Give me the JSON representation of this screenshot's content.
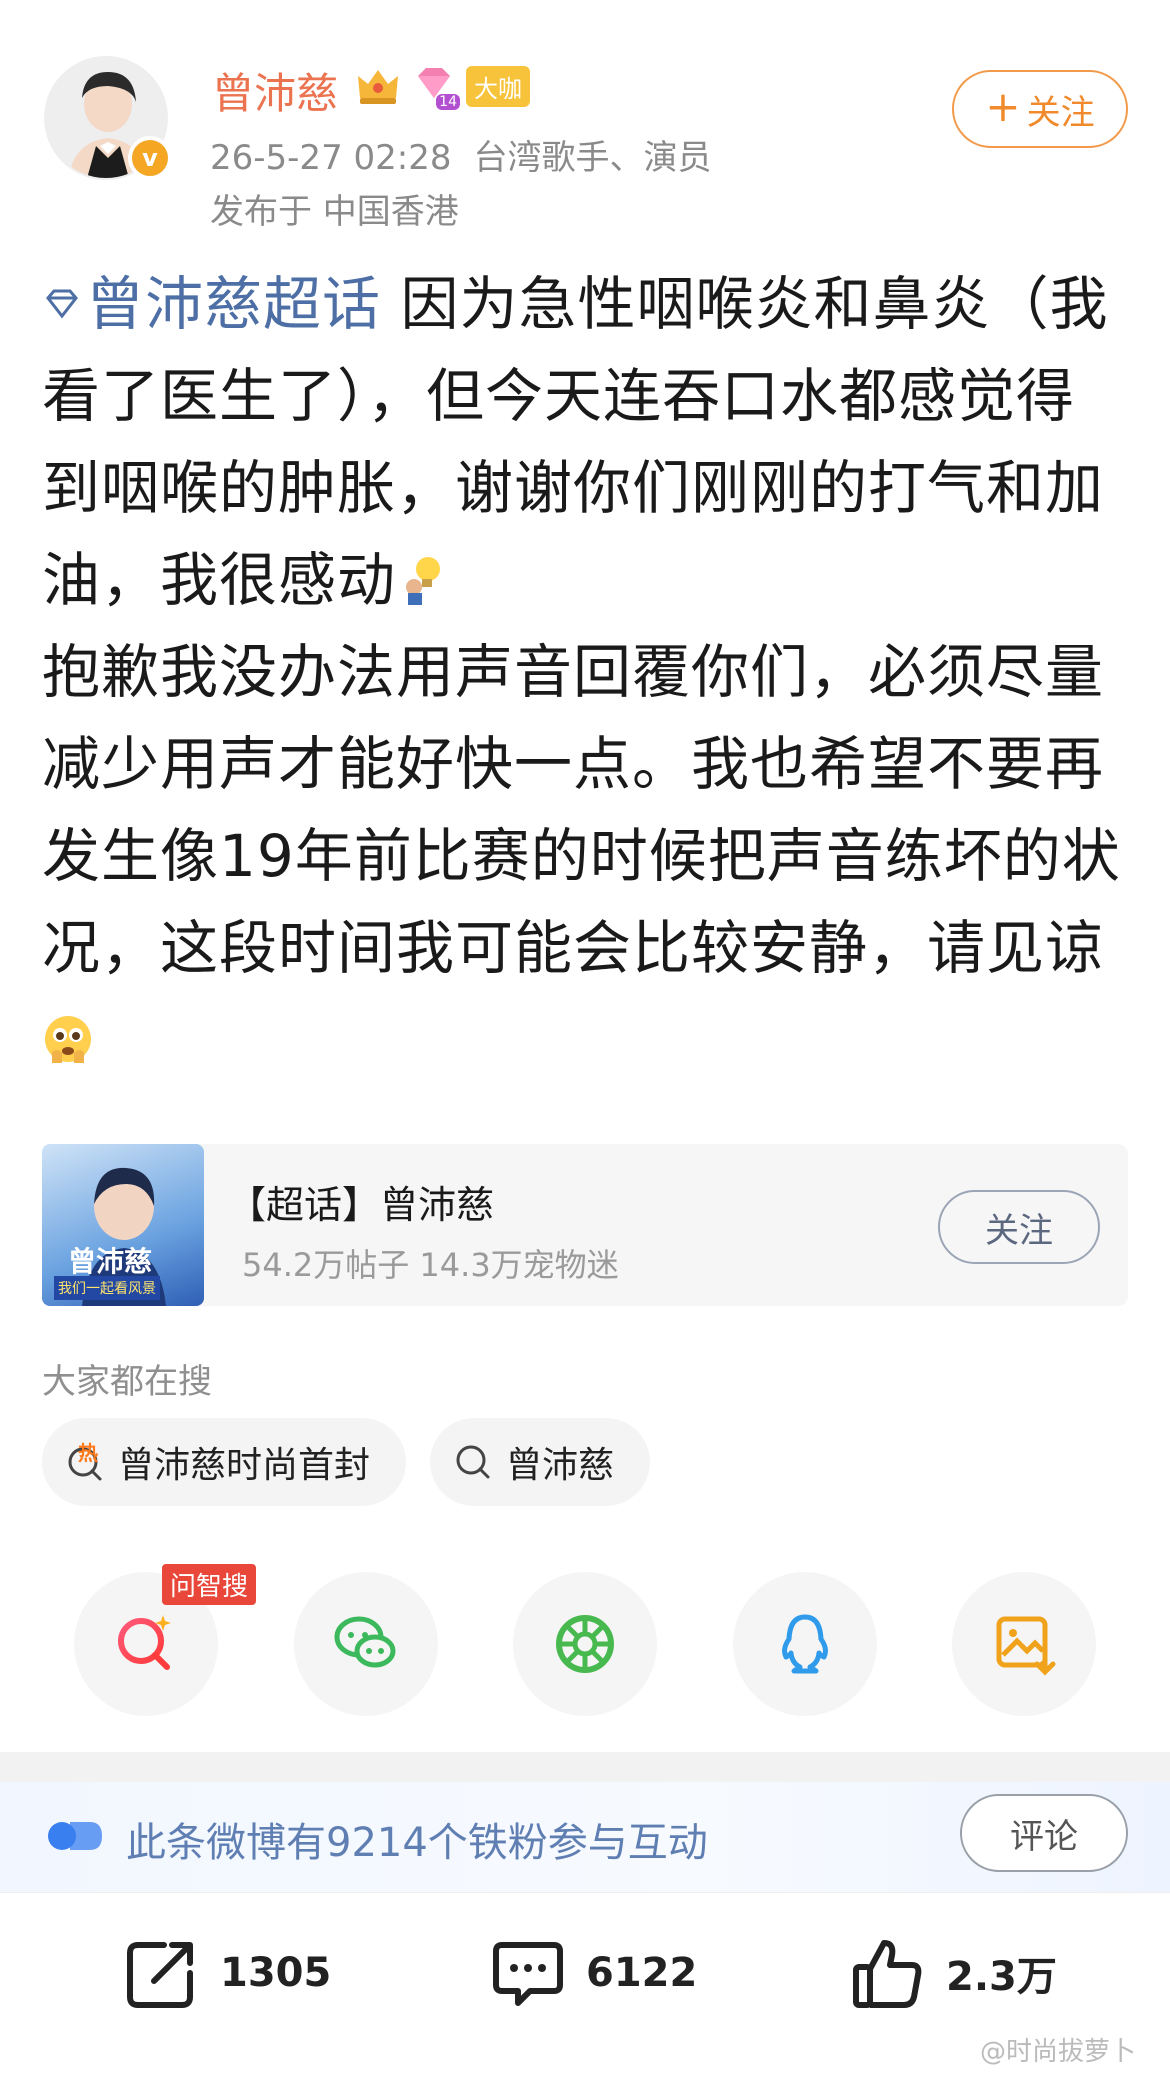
{
  "user": {
    "name": "曾沛慈",
    "vip_level": "14",
    "level_badge": "大咖",
    "verified_mark": "v",
    "time": "26-5-27 02:28",
    "description": "台湾歌手、演员",
    "location": "发布于 中国香港",
    "follow_label": "关注",
    "follow_plus": "+"
  },
  "post": {
    "topic": "曾沛慈超话",
    "text_1": " 因为急性咽喉炎和鼻炎（我看了医生了），但今天连吞口水都感觉得到咽喉的肿胀，谢谢你们刚刚的打气和加油，我很感动",
    "text_2": "抱歉我没办法用声音回覆你们，必须尽量减少用声才能好快一点。我也希望不要再发生像19年前比赛的时候把声音练坏的状况，这段时间我可能会比较安静，请见谅"
  },
  "topic_card": {
    "cover_title": "曾沛慈",
    "cover_sub": "我们一起看风景",
    "title": "【超话】曾沛慈",
    "stats": "54.2万帖子 14.3万宠物迷",
    "follow_label": "关注"
  },
  "search": {
    "heading": "大家都在搜",
    "chips": [
      "曾沛慈时尚首封",
      "曾沛慈"
    ],
    "hot_mark": "热"
  },
  "share": {
    "ask_tag": "问智搜",
    "icons": [
      "search-ai-icon",
      "wechat-icon",
      "moments-icon",
      "qq-icon",
      "save-image-icon"
    ]
  },
  "fans": {
    "text": "此条微博有9214个铁粉参与互动",
    "comment_label": "评论"
  },
  "actions": {
    "repost_count": "1305",
    "comment_count": "6122",
    "like_count": "2.3万"
  },
  "watermark": "@时尚拔萝卜",
  "colors": {
    "name": "#eb7350",
    "topic_link": "#4d6fa5",
    "follow": "#f08a2c",
    "ask_tag": "#e8473a"
  }
}
